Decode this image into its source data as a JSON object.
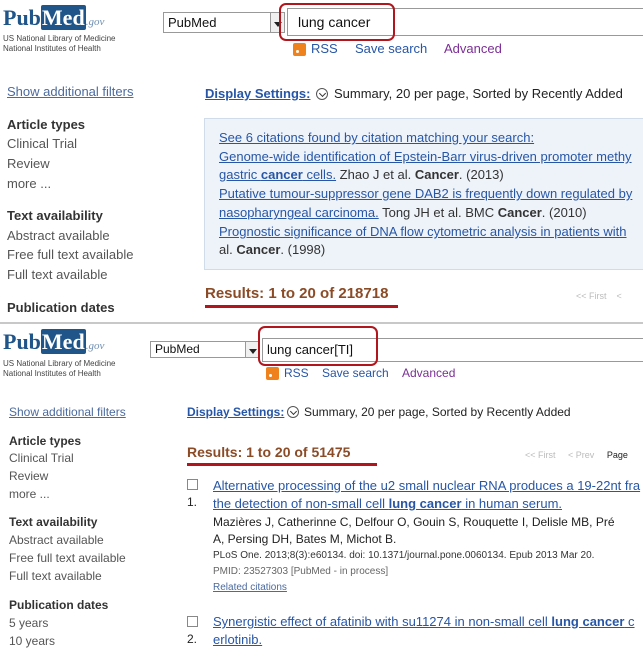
{
  "brand": {
    "pub": "Pub",
    "med": "Med",
    "gov": ".gov",
    "line1": "US National Library of Medicine",
    "line2": "National Institutes of Health"
  },
  "colors": {
    "link": "#2756a6",
    "results": "#8b4b26",
    "highlight": "#b2161d",
    "advanced": "#7b2e94"
  },
  "top": {
    "db_select": "PubMed",
    "search_value": "lung cancer",
    "rss": "RSS",
    "save_search": "Save search",
    "advanced": "Advanced",
    "show_filters": "Show additional filters",
    "article_types": "Article types",
    "clinical_trial": "Clinical Trial",
    "review": "Review",
    "more": "more ...",
    "text_availability": "Text availability",
    "abstract_available": "Abstract available",
    "free_full_text": "Free full text available",
    "full_text": "Full text available",
    "publication_dates": "Publication dates",
    "display_settings": "Display Settings:",
    "display_summary": "Summary, 20 per page, Sorted by Recently Added",
    "citations": {
      "header": "See 6 citations found by citation matching your search:",
      "c1_title_a": "Genome-wide identification of Epstein-Barr virus-driven promoter methy",
      "c1_title_b1": "gastric ",
      "c1_title_b2": "cancer",
      "c1_title_b3": " cells.",
      "c1_meta1": " Zhao J et al. ",
      "c1_meta2": "Cancer",
      "c1_meta3": ". (2013)",
      "c2_title_a": "Putative tumour-suppressor gene DAB2 is frequently down regulated by",
      "c2_title_b": "nasopharyngeal carcinoma.",
      "c2_meta1": " Tong JH et al. BMC ",
      "c2_meta2": "Cancer",
      "c2_meta3": ". (2010)",
      "c3_title_a": "Prognostic significance of DNA flow cytometric analysis in patients with",
      "c3_meta0": "al. ",
      "c3_meta1": "Cancer",
      "c3_meta2": ". (1998)"
    },
    "results": "Results: 1 to 20 of 218718",
    "pager_first": "<< First",
    "pager_prev": "<"
  },
  "bottom": {
    "db_select": "PubMed",
    "search_value": "lung cancer[TI]",
    "rss": "RSS",
    "save_search": "Save search",
    "advanced": "Advanced",
    "show_filters": "Show additional filters",
    "article_types": "Article types",
    "clinical_trial": "Clinical Trial",
    "review": "Review",
    "more": "more ...",
    "text_availability": "Text availability",
    "abstract_available": "Abstract available",
    "free_full_text": "Free full text available",
    "full_text": "Full text available",
    "publication_dates": "Publication dates",
    "five_years": "5 years",
    "ten_years": "10 years",
    "display_settings": "Display Settings:",
    "display_summary": "Summary, 20 per page, Sorted by Recently Added",
    "results": "Results: 1 to 20 of 51475",
    "pager_first": "<< First",
    "pager_prev": "< Prev",
    "pager_page": "Page",
    "items": [
      {
        "num": "1.",
        "title_a": "Alternative processing of the u2 small nuclear RNA produces a 19-22nt fra",
        "title_b1": "the detection of non-small cell ",
        "title_b2": "lung cancer",
        "title_b3": " in human serum.",
        "authors_a": "Mazières J, Catherinne C, Delfour O, Gouin S, Rouquette I, Delisle MB, Pré",
        "authors_b": "A, Persing DH, Bates M, Michot B.",
        "source": "PLoS One. 2013;8(3):e60134. doi: 10.1371/journal.pone.0060134. Epub 2013 Mar 20.",
        "pmid": "PMID: 23527303 [PubMed - in process]",
        "related": "Related citations"
      },
      {
        "num": "2.",
        "title_a1": "Synergistic effect of afatinib with su11274 in non-small cell ",
        "title_a2": "lung cancer",
        "title_a3": " c",
        "title_b": "erlotinib."
      }
    ]
  }
}
